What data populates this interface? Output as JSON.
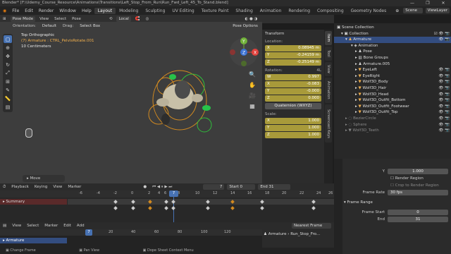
{
  "window": {
    "title": "Blender* [F:\\Udemy_Course_Resource\\Animations\\Transitions\\Left_Stop_From_Run\\Run_Fwd_Left_45_To_Stand.blend]",
    "min": "—",
    "max": "❐",
    "close": "✕"
  },
  "menu": [
    "File",
    "Edit",
    "Render",
    "Window",
    "Help"
  ],
  "workspaces": [
    "Layout",
    "Modeling",
    "Sculpting",
    "UV Editing",
    "Texture Paint",
    "Shading",
    "Animation",
    "Rendering",
    "Compositing",
    "Geometry Nodes"
  ],
  "active_workspace": "Layout",
  "scene_label": "Scene",
  "viewlayer_label": "ViewLayer",
  "viewport_header": {
    "mode": "Pose Mode",
    "menus": [
      "View",
      "Select",
      "Pose"
    ],
    "pivot": "Local",
    "options": "Pose Options"
  },
  "viewport_header2": {
    "orientation_label": "Orientation:",
    "orientation_value": "Default",
    "drag_label": "Drag:",
    "drag_value": "Select Box"
  },
  "viewport_info": {
    "view": "Top Orthographic",
    "object": "(7) Armature : CTRL_PelvisRotate.001",
    "scale": "10 Centimeters"
  },
  "gizmo": {
    "x": "X",
    "y": "Y",
    "z": "Z"
  },
  "last_op": "Move",
  "transform": {
    "header": "Transform",
    "location_label": "Location:",
    "location": [
      {
        "axis": "X",
        "value": "0.08945 m"
      },
      {
        "axis": "Y",
        "value": "-0.24159 m"
      },
      {
        "axis": "Z",
        "value": "-0.25149 m"
      }
    ],
    "rotation_label": "Rotation:",
    "rotation_mode_tag": "4L",
    "rotation": [
      {
        "axis": "W",
        "value": "0.997"
      },
      {
        "axis": "X",
        "value": "-0.083"
      },
      {
        "axis": "Y",
        "value": "-0.000"
      },
      {
        "axis": "Z",
        "value": "0.000"
      }
    ],
    "rotation_mode": "Quaternion (WXYZ)",
    "scale_label": "Scale:",
    "scale": [
      {
        "axis": "X",
        "value": "1.000"
      },
      {
        "axis": "Y",
        "value": "1.000"
      },
      {
        "axis": "Z",
        "value": "1.000"
      }
    ]
  },
  "side_tabs": [
    "Item",
    "Tool",
    "View",
    "Animation",
    "Screencast Keys"
  ],
  "outliner": {
    "rows": [
      {
        "label": "Scene Collection",
        "indent": 0
      },
      {
        "label": "Collection",
        "indent": 1
      },
      {
        "label": "Armature",
        "indent": 2
      },
      {
        "label": "Animation",
        "indent": 3
      },
      {
        "label": "Pose",
        "indent": 3
      },
      {
        "label": "Bone Groups",
        "indent": 3
      },
      {
        "label": "Armature.005",
        "indent": 3
      },
      {
        "label": "EyeLeft",
        "indent": 3
      },
      {
        "label": "EyeRight",
        "indent": 3
      },
      {
        "label": "Wolf3D_Body",
        "indent": 3
      },
      {
        "label": "Wolf3D_Hair",
        "indent": 3
      },
      {
        "label": "Wolf3D_Head",
        "indent": 3
      },
      {
        "label": "Wolf3D_Outfit_Bottom",
        "indent": 3
      },
      {
        "label": "Wolf3D_Outfit_Footwear",
        "indent": 3
      },
      {
        "label": "Wolf3D_Outfit_Top",
        "indent": 3
      },
      {
        "label": "BezierCircle",
        "indent": 2
      },
      {
        "label": "Sphere",
        "indent": 2
      },
      {
        "label": "Wolf3D_Teeth",
        "indent": 2
      }
    ]
  },
  "properties": {
    "y_label": "Y",
    "y_value": "1.000",
    "render_region": "Render Region",
    "crop": "Crop to Render Region",
    "frame_rate_label": "Frame Rate",
    "frame_rate": "30 fps",
    "frame_range_header": "Frame Range",
    "frame_start_label": "Frame Start",
    "frame_start": "0",
    "end_label": "End",
    "end": "31"
  },
  "timeline": {
    "menus": [
      "Playback",
      "Keying",
      "View",
      "Marker"
    ],
    "current_frame": "7",
    "start_label": "Start",
    "start": "0",
    "end_label": "End",
    "end": "31",
    "ticks": [
      "-6",
      "-4",
      "-2",
      "0",
      "2",
      "4",
      "6",
      "7",
      "8",
      "10",
      "12",
      "14",
      "16",
      "18",
      "20",
      "22",
      "24",
      "26"
    ],
    "summary": "Summary"
  },
  "graph": {
    "menus": [
      "View",
      "Select",
      "Marker",
      "Edit",
      "Add"
    ],
    "nearest": "Nearest Frame",
    "ticks": [
      "0",
      "20",
      "40",
      "60",
      "80",
      "100",
      "120"
    ],
    "cur": "7",
    "channel": "Armature",
    "channel2": "Armature",
    "action": "Run_Stop_Fro..."
  },
  "status": {
    "left": "Change Frame",
    "mid": "Pan View",
    "right": "Dope Sheet Context Menu"
  },
  "colors": {
    "accent": "#4772b3",
    "yellow": "#a89a3a",
    "orange": "#d28a20",
    "green": "#2fbf3b"
  }
}
